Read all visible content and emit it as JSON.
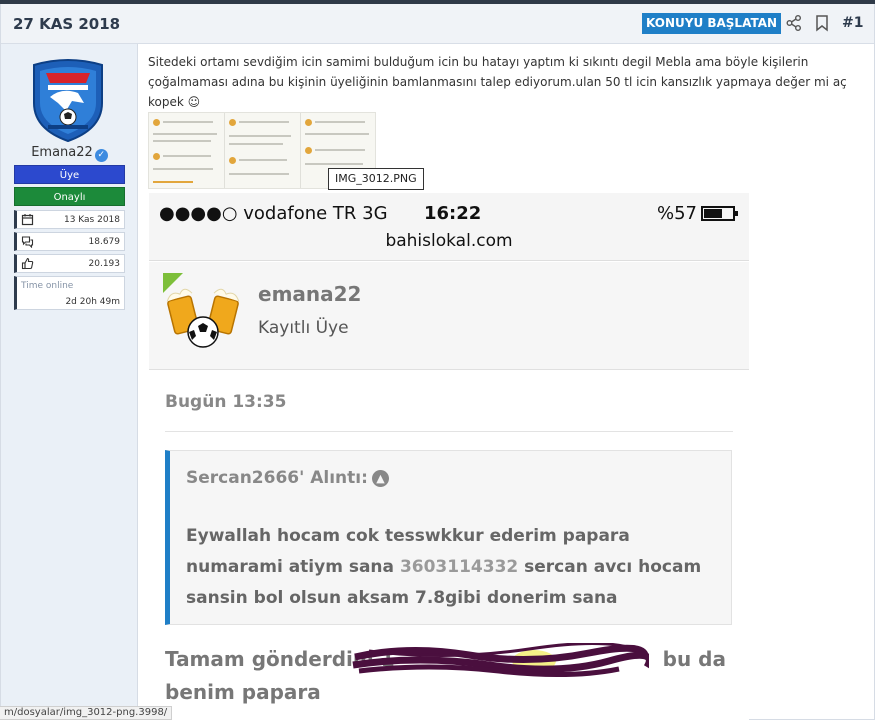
{
  "post": {
    "date": "27 KAS 2018",
    "start_topic_label": "KONUYU BAŞLATAN",
    "post_number": "#1",
    "share_icon": "share-icon",
    "bookmark_icon": "bookmark-icon"
  },
  "author": {
    "username": "Emana22",
    "role_primary": "Üye",
    "role_secondary": "Onaylı",
    "stats": {
      "joined": "13 Kas 2018",
      "messages": "18.679",
      "reactions": "20.193",
      "time_online_label": "Time online",
      "time_online": "2d 20h 49m"
    }
  },
  "message": {
    "text": "Sitedeki ortamı sevdiğim icin samimi bulduğum icin bu hatayı yaptım ki sıkıntı degil Mebla ama böyle kişilerin çoğalmaması adına bu kişinin üyeliğinin bamlanmasını talep ediyorum.ulan 50 tl icin kansızlık yapmaya değer mi aç kopek ☺",
    "attachment_tooltip": "IMG_3012.PNG"
  },
  "screenshot": {
    "carrier": "●●●●○ vodafone TR   3G",
    "time": "16:22",
    "battery": "%57",
    "url": "bahislokal.com",
    "user_name": "emana22",
    "user_role": "Kayıtlı Üye",
    "post_time": "Bugün 13:35",
    "quote_author": "Sercan2666' Alıntı:",
    "quote_text_before": "Eywallah hocam cok tesswkkur ederim papara numarami atiym sana ",
    "quote_number": "3603114332",
    "quote_text_after": " sercan avcı hocam sansin bol olsun aksam 7.8gibi donerim sana",
    "reply_text": "Tamam gönderdim 1",
    "reply_tail": "bu da benim papara"
  },
  "status_link": "m/dosyalar/img_3012-png.3998/",
  "colors": {
    "accent_blue": "#1f7fc7",
    "role_uye": "#2c49ce",
    "role_onayli": "#1c8a3a"
  }
}
